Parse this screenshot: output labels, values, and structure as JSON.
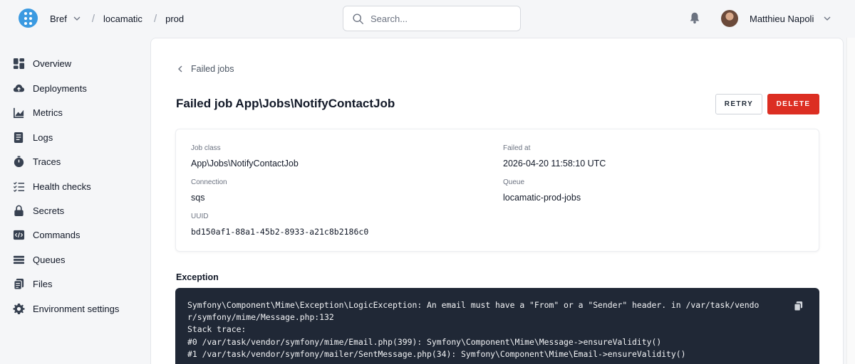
{
  "breadcrumb": {
    "org": "Bref",
    "app": "locamatic",
    "env": "prod",
    "separator": "/"
  },
  "search": {
    "placeholder": "Search..."
  },
  "user": {
    "name": "Matthieu Napoli"
  },
  "sidebar": {
    "items": [
      {
        "label": "Overview",
        "icon": "grid-icon"
      },
      {
        "label": "Deployments",
        "icon": "cloud-upload-icon"
      },
      {
        "label": "Metrics",
        "icon": "chart-icon"
      },
      {
        "label": "Logs",
        "icon": "logs-icon"
      },
      {
        "label": "Traces",
        "icon": "stopwatch-icon"
      },
      {
        "label": "Health checks",
        "icon": "checklist-icon"
      },
      {
        "label": "Secrets",
        "icon": "lock-icon"
      },
      {
        "label": "Commands",
        "icon": "code-icon"
      },
      {
        "label": "Queues",
        "icon": "queue-icon"
      },
      {
        "label": "Files",
        "icon": "files-icon"
      },
      {
        "label": "Environment settings",
        "icon": "gear-icon"
      }
    ]
  },
  "page": {
    "back_label": "Failed jobs",
    "title": "Failed job App\\Jobs\\NotifyContactJob",
    "retry_label": "RETRY",
    "delete_label": "DELETE"
  },
  "details": {
    "job_class": {
      "label": "Job class",
      "value": "App\\Jobs\\NotifyContactJob"
    },
    "failed_at": {
      "label": "Failed at",
      "value": "2026-04-20 11:58:10 UTC"
    },
    "connection": {
      "label": "Connection",
      "value": "sqs"
    },
    "queue": {
      "label": "Queue",
      "value": "locamatic-prod-jobs"
    },
    "uuid": {
      "label": "UUID",
      "value": "bd150af1-88a1-45b2-8933-a21c8b2186c0"
    }
  },
  "exception": {
    "title": "Exception",
    "lines": [
      "Symfony\\Component\\Mime\\Exception\\LogicException: An email must have a \"From\" or a \"Sender\" header. in /var/task/vendo",
      "r/symfony/mime/Message.php:132",
      "Stack trace:",
      "#0 /var/task/vendor/symfony/mime/Email.php(399): Symfony\\Component\\Mime\\Message->ensureValidity()",
      "#1 /var/task/vendor/symfony/mailer/SentMessage.php(34): Symfony\\Component\\Mime\\Email->ensureValidity()"
    ]
  },
  "colors": {
    "accent": "#3b9ae1",
    "danger": "#dc2e22",
    "code_bg": "#202836"
  }
}
